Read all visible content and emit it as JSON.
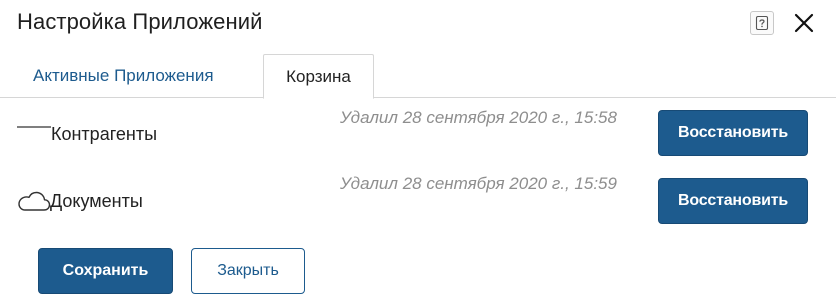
{
  "dialog": {
    "title": "Настройка Приложений",
    "help_icon": "question-icon",
    "close_icon": "close-icon"
  },
  "tabs": [
    {
      "label": "Активные Приложения",
      "active": false
    },
    {
      "label": "Корзина",
      "active": true
    }
  ],
  "trash_items": [
    {
      "icon": "line-icon",
      "name": "Контрагенты",
      "deleted_text": "Удалил 28 сентября 2020 г., 15:58",
      "restore_label": "Восстановить"
    },
    {
      "icon": "cloud-icon",
      "name": "Документы",
      "deleted_text": "Удалил 28 сентября 2020 г., 15:59",
      "restore_label": "Восстановить"
    }
  ],
  "footer": {
    "save_label": "Сохранить",
    "close_label": "Закрыть"
  },
  "colors": {
    "primary": "#1d5b8e",
    "muted_text": "#8e8e8e",
    "border": "#d6d6d6"
  }
}
